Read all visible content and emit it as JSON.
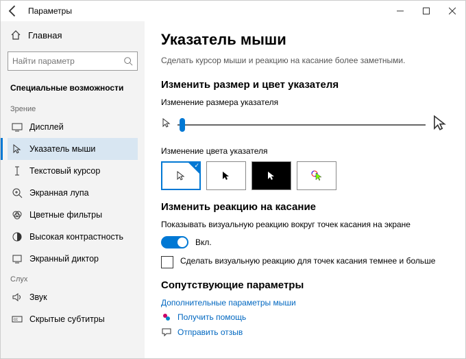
{
  "window": {
    "title": "Параметры"
  },
  "sidebar": {
    "home": "Главная",
    "search_placeholder": "Найти параметр",
    "group": "Специальные возможности",
    "cat_vision": "Зрение",
    "cat_hearing": "Слух",
    "items": [
      {
        "label": "Дисплей"
      },
      {
        "label": "Указатель мыши"
      },
      {
        "label": "Текстовый курсор"
      },
      {
        "label": "Экранная лупа"
      },
      {
        "label": "Цветные фильтры"
      },
      {
        "label": "Высокая контрастность"
      },
      {
        "label": "Экранный диктор"
      },
      {
        "label": "Звук"
      },
      {
        "label": "Скрытые субтитры"
      }
    ]
  },
  "main": {
    "title": "Указатель мыши",
    "subtitle": "Сделать курсор мыши и реакцию на касание более заметными.",
    "h_size_color": "Изменить размер и цвет указателя",
    "lbl_size": "Изменение размера указателя",
    "lbl_color": "Изменение цвета указателя",
    "h_touch": "Изменить реакцию на касание",
    "touch_desc": "Показывать визуальную реакцию вокруг точек касания на экране",
    "toggle_on": "Вкл.",
    "check_text": "Сделать визуальную реакцию для точек касания темнее и больше",
    "h_related": "Сопутствующие параметры",
    "link_more": "Дополнительные параметры мыши",
    "help": "Получить помощь",
    "feedback": "Отправить отзыв"
  }
}
